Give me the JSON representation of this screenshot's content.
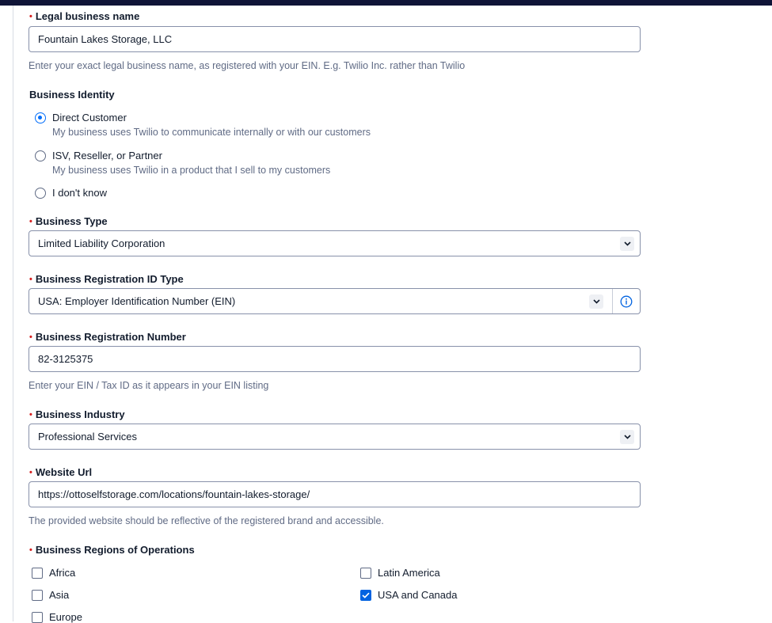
{
  "legal_name": {
    "label": "Legal business name",
    "value": "Fountain Lakes Storage, LLC",
    "help": "Enter your exact legal business name, as registered with your EIN. E.g. Twilio Inc. rather than Twilio"
  },
  "identity": {
    "label": "Business Identity",
    "options": [
      {
        "title": "Direct Customer",
        "desc": "My business uses Twilio to communicate internally or with our customers",
        "selected": true
      },
      {
        "title": "ISV, Reseller, or Partner",
        "desc": "My business uses Twilio in a product that I sell to my customers",
        "selected": false
      },
      {
        "title": "I don't know",
        "desc": "",
        "selected": false
      }
    ]
  },
  "business_type": {
    "label": "Business Type",
    "value": "Limited Liability Corporation"
  },
  "reg_id_type": {
    "label": "Business Registration ID Type",
    "value": "USA: Employer Identification Number (EIN)"
  },
  "reg_number": {
    "label": "Business Registration Number",
    "value": "82-3125375",
    "help": "Enter your EIN / Tax ID as it appears in your EIN listing"
  },
  "industry": {
    "label": "Business Industry",
    "value": "Professional Services"
  },
  "website": {
    "label": "Website Url",
    "value": "https://ottoselfstorage.com/locations/fountain-lakes-storage/",
    "help": "The provided website should be reflective of the registered brand and accessible."
  },
  "regions": {
    "label": "Business Regions of Operations",
    "options": [
      {
        "label": "Africa",
        "checked": false
      },
      {
        "label": "Asia",
        "checked": false
      },
      {
        "label": "Europe",
        "checked": false
      },
      {
        "label": "Latin America",
        "checked": false
      },
      {
        "label": "USA and Canada",
        "checked": true
      }
    ]
  },
  "colors": {
    "accent": "#0263e0",
    "required": "#d61f1f",
    "header": "#0f1437"
  }
}
